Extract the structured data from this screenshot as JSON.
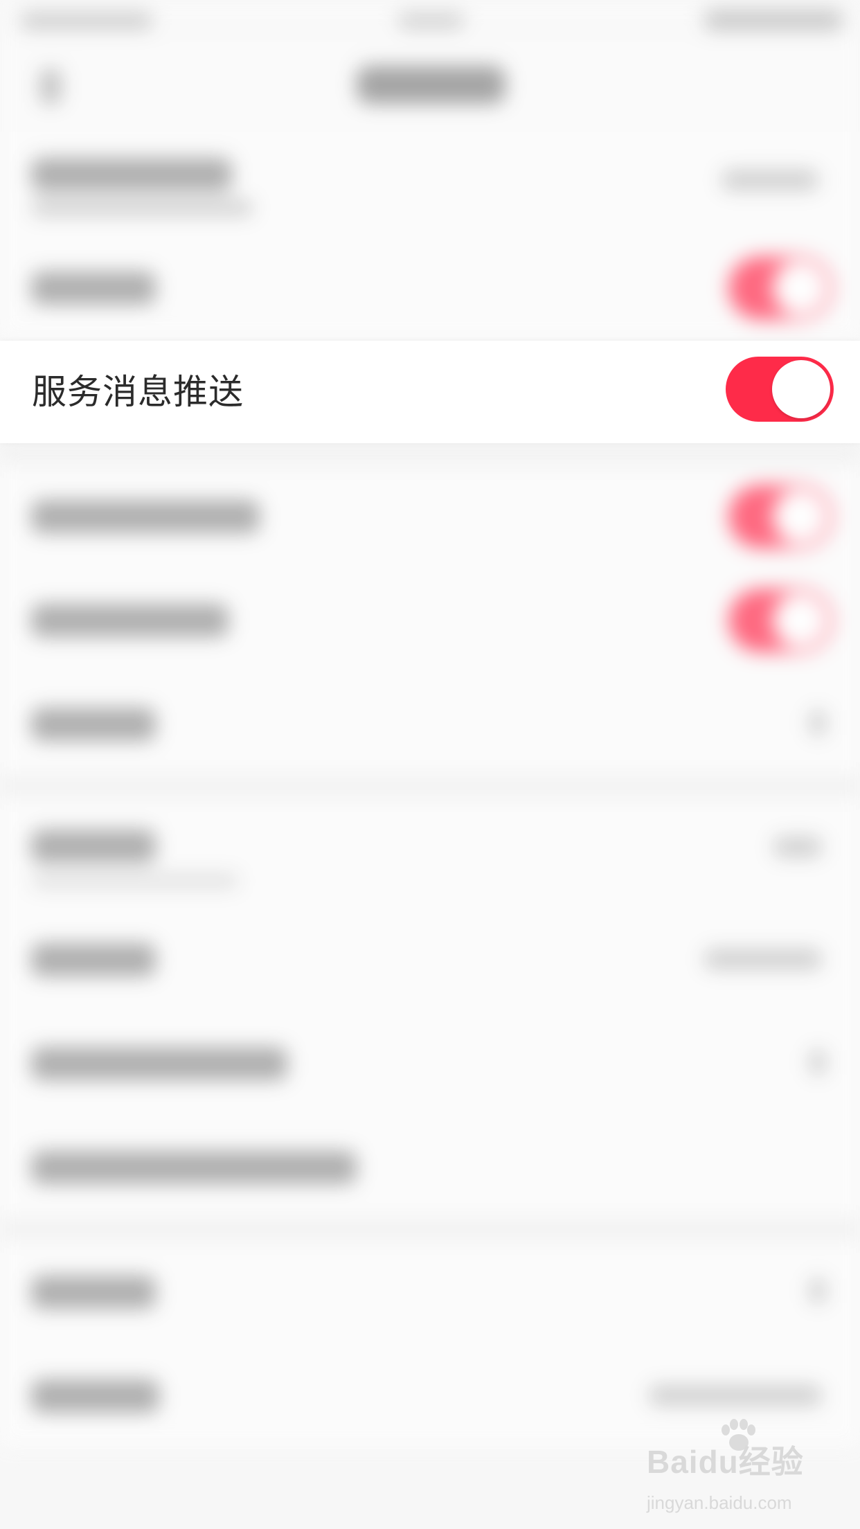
{
  "service_push": {
    "label": "服务消息推送",
    "enabled": true,
    "toggle_color": "#fe2b49"
  },
  "watermark": {
    "brand": "Baidu经验",
    "url": "jingyan.baidu.com"
  },
  "colors": {
    "accent": "#fe2b49",
    "background": "#f7f7f7"
  }
}
